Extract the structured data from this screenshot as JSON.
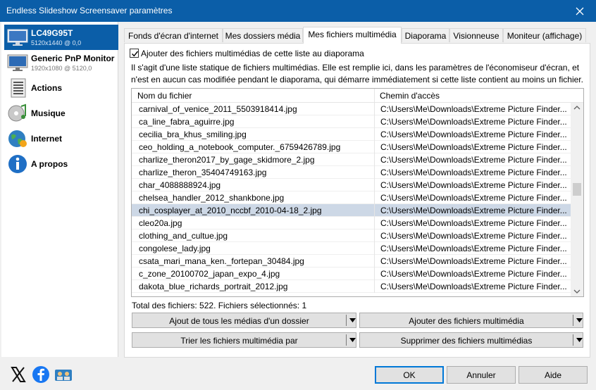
{
  "window": {
    "title": "Endless Slideshow Screensaver paramètres"
  },
  "sidebar": {
    "items": [
      {
        "label": "LC49G95T",
        "sub": "5120x1440 @ 0,0",
        "icon": "monitor-icon",
        "selected": true
      },
      {
        "label": "Generic PnP Monitor",
        "sub": "1920x1080 @ 5120,0",
        "icon": "monitor-icon"
      },
      {
        "label": "Actions",
        "icon": "actions-list-icon"
      },
      {
        "label": "Musique",
        "icon": "music-icon"
      },
      {
        "label": "Internet",
        "icon": "internet-globe-icon"
      },
      {
        "label": "A propos",
        "icon": "info-icon"
      }
    ]
  },
  "tabs": [
    {
      "label": "Fonds d'écran d'internet"
    },
    {
      "label": "Mes dossiers média"
    },
    {
      "label": "Mes fichiers multimédia",
      "active": true
    },
    {
      "label": "Diaporama"
    },
    {
      "label": "Visionneuse"
    },
    {
      "label": "Moniteur (affichage)"
    }
  ],
  "panel": {
    "checkbox_label": "Ajouter des fichiers multimédias de cette liste au diaporama",
    "checkbox_checked": true,
    "description": "Il s'agit d'une liste statique de fichiers multimédias. Elle est remplie ici, dans les paramètres de l'économiseur d'écran, et n'est en aucun cas modifiée pendant le diaporama, qui démarre immédiatement si cette liste contient au moins un fichier.",
    "list": {
      "col_name": "Nom du fichier",
      "col_path": "Chemin d'accès",
      "rows": [
        {
          "name": "carnival_of_venice_2011_5503918414.jpg",
          "path": "C:\\Users\\Me\\Downloads\\Extreme Picture Finder..."
        },
        {
          "name": "ca_line_fabra_aguirre.jpg",
          "path": "C:\\Users\\Me\\Downloads\\Extreme Picture Finder..."
        },
        {
          "name": "cecilia_bra_khus_smiling.jpg",
          "path": "C:\\Users\\Me\\Downloads\\Extreme Picture Finder..."
        },
        {
          "name": "ceo_holding_a_notebook_computer._6759426789.jpg",
          "path": "C:\\Users\\Me\\Downloads\\Extreme Picture Finder..."
        },
        {
          "name": "charlize_theron2017_by_gage_skidmore_2.jpg",
          "path": "C:\\Users\\Me\\Downloads\\Extreme Picture Finder..."
        },
        {
          "name": "charlize_theron_35404749163.jpg",
          "path": "C:\\Users\\Me\\Downloads\\Extreme Picture Finder..."
        },
        {
          "name": "char_4088888924.jpg",
          "path": "C:\\Users\\Me\\Downloads\\Extreme Picture Finder..."
        },
        {
          "name": "chelsea_handler_2012_shankbone.jpg",
          "path": "C:\\Users\\Me\\Downloads\\Extreme Picture Finder..."
        },
        {
          "name": "chi_cosplayer_at_2010_nccbf_2010-04-18_2.jpg",
          "path": "C:\\Users\\Me\\Downloads\\Extreme Picture Finder...",
          "selected": true
        },
        {
          "name": "cleo20a.jpg",
          "path": "C:\\Users\\Me\\Downloads\\Extreme Picture Finder..."
        },
        {
          "name": "clothing_and_cultue.jpg",
          "path": "C:\\Users\\Me\\Downloads\\Extreme Picture Finder..."
        },
        {
          "name": "congolese_lady.jpg",
          "path": "C:\\Users\\Me\\Downloads\\Extreme Picture Finder..."
        },
        {
          "name": "csata_mari_mana_ken._fortepan_30484.jpg",
          "path": "C:\\Users\\Me\\Downloads\\Extreme Picture Finder..."
        },
        {
          "name": "c_zone_20100702_japan_expo_4.jpg",
          "path": "C:\\Users\\Me\\Downloads\\Extreme Picture Finder..."
        },
        {
          "name": "dakota_blue_richards_portrait_2012.jpg",
          "path": "C:\\Users\\Me\\Downloads\\Extreme Picture Finder..."
        }
      ]
    },
    "totals": "Total des fichiers: 522. Fichiers sélectionnés: 1",
    "buttons": {
      "add_folder": "Ajout de tous les médias d'un dossier",
      "add_files": "Ajouter des fichiers multimédia",
      "sort": "Trier les fichiers multimédia par",
      "delete": "Supprimer des fichiers multimédias"
    }
  },
  "footer": {
    "icons": [
      "x-icon",
      "facebook-icon",
      "community-icon"
    ],
    "ok": "OK",
    "cancel": "Annuler",
    "help": "Aide"
  },
  "colors": {
    "accent": "#0b5ea8",
    "selected_row": "#cdd8e6",
    "ok_border": "#0078d7"
  }
}
